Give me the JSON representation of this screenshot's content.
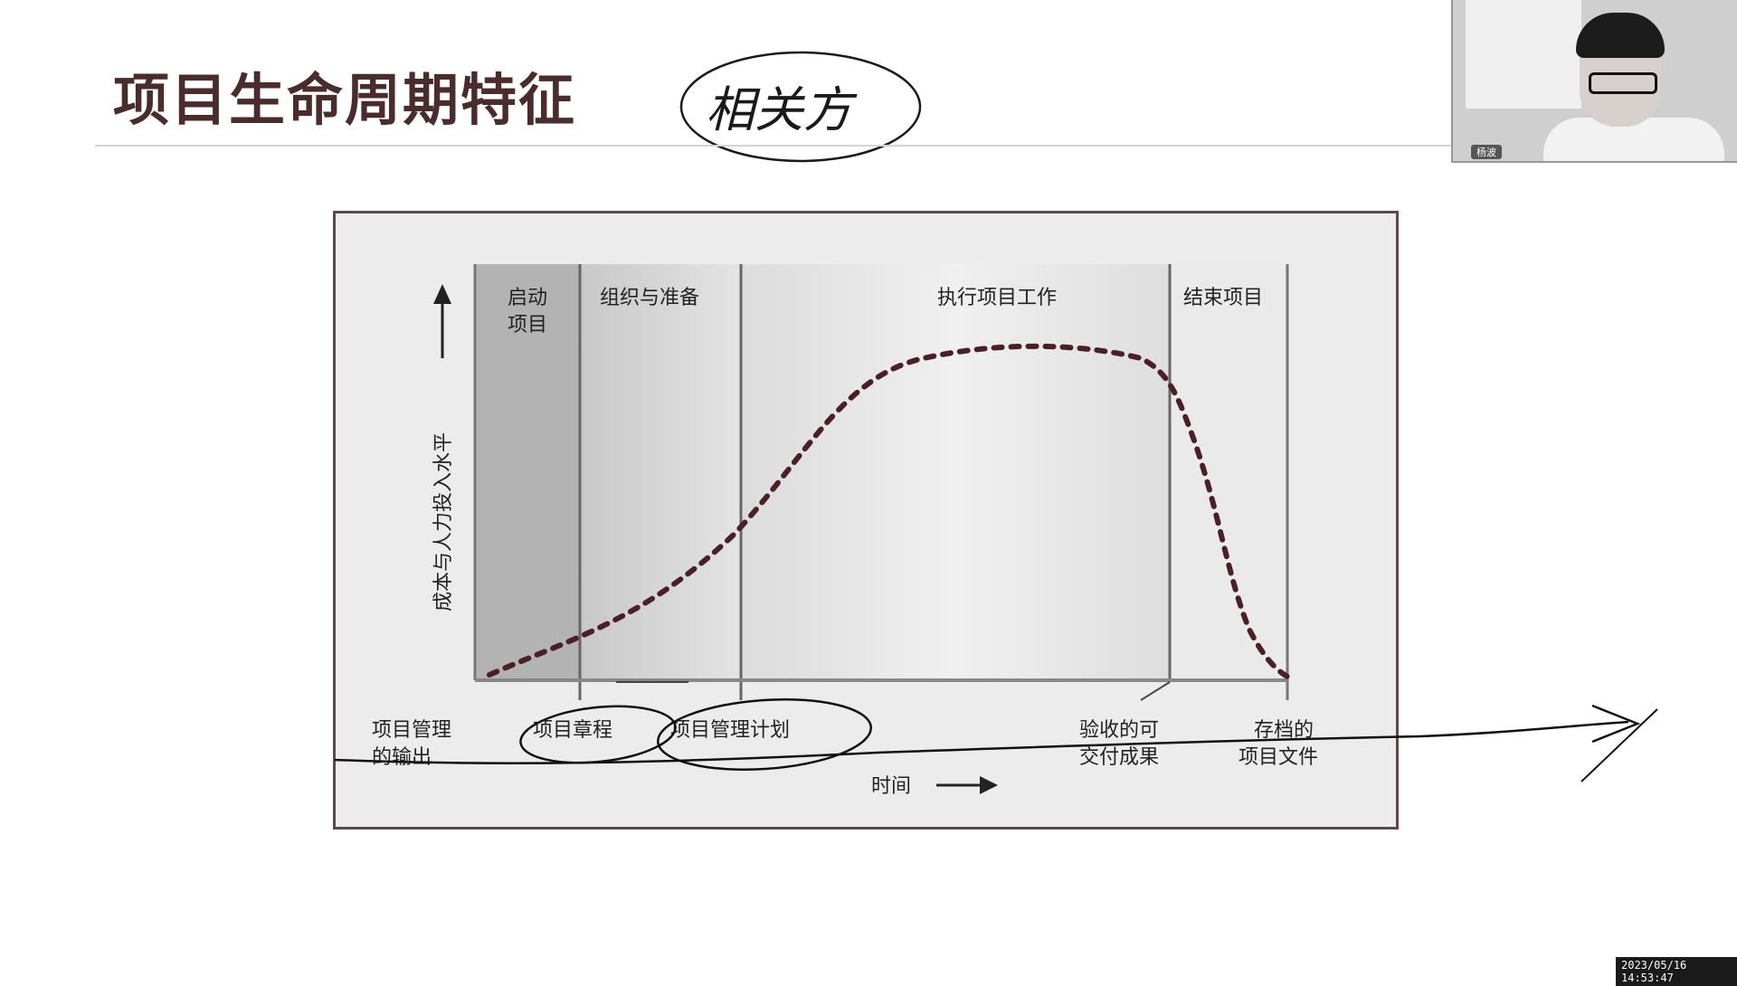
{
  "slide": {
    "title": "项目生命周期特征",
    "handwritten_note": "相关方"
  },
  "diagram": {
    "phases": [
      {
        "label_line1": "启动",
        "label_line2": "项目"
      },
      {
        "label_line1": "组织与准备",
        "label_line2": ""
      },
      {
        "label_line1": "执行项目工作",
        "label_line2": ""
      },
      {
        "label_line1": "结束项目",
        "label_line2": ""
      }
    ],
    "y_axis_label": "成本与人力投入水平",
    "x_axis_label": "时间",
    "outputs": [
      {
        "line1": "项目管理",
        "line2": "的输出"
      },
      {
        "line1": "项目章程",
        "line2": ""
      },
      {
        "line1": "项目管理计划",
        "line2": ""
      },
      {
        "line1": "验收的可",
        "line2": "交付成果"
      },
      {
        "line1": "存档的",
        "line2": "项目文件"
      }
    ]
  },
  "webcam": {
    "name_tag": "杨波"
  },
  "timestamp": "2023/05/16 14:53:47",
  "colors": {
    "title": "#4a2c2c",
    "curve": "#4a1f28",
    "ink": "#1a1a1a",
    "phase_dark": "#b5b5b5",
    "phase_mid": "#d0d0d0",
    "phase_light": "#e2e2e2"
  }
}
